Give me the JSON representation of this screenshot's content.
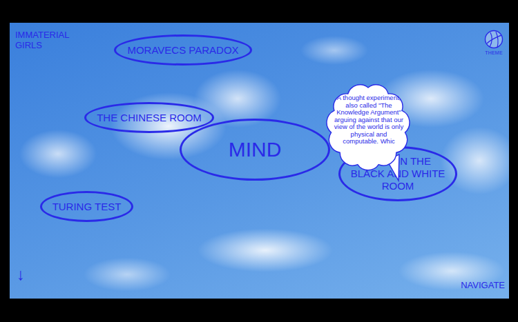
{
  "brand": "IMMATERIAL GIRLS",
  "theme": {
    "label": "THEME"
  },
  "nodes": [
    {
      "label": "MORAVECS PARADOX",
      "kind": "topic"
    },
    {
      "label": "THE CHINESE ROOM",
      "kind": "topic"
    },
    {
      "label": "MIND",
      "kind": "center"
    },
    {
      "label": "MARY IN THE BLACK AND WHITE ROOM",
      "kind": "topic"
    },
    {
      "label": "TURING TEST",
      "kind": "topic"
    }
  ],
  "tooltip": {
    "text": "A thought experiment, also called \"The Knowledge Argument\" arguing against that our view of the world is only physical and computable. Whic"
  },
  "scroll": {
    "icon": "↓"
  },
  "navigate": "NAVIGATE"
}
